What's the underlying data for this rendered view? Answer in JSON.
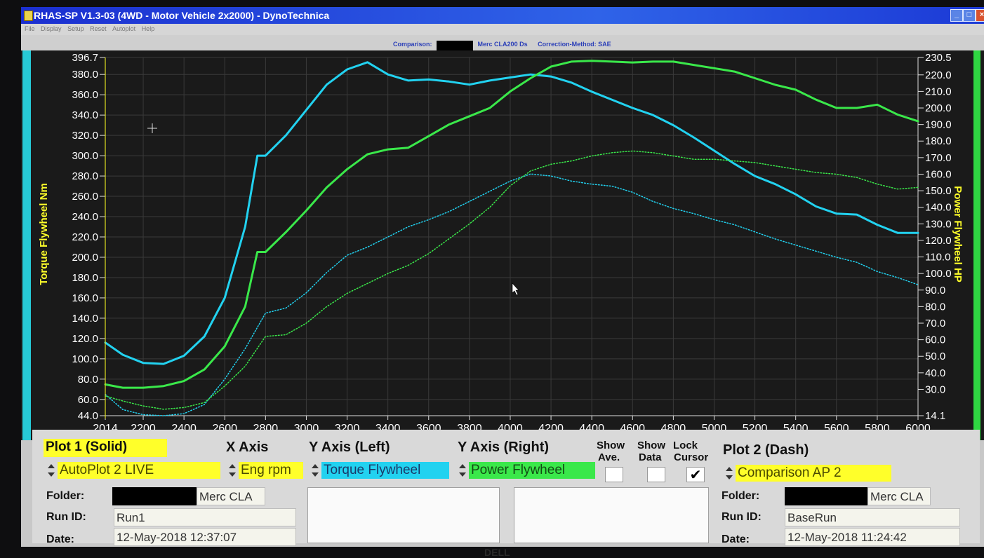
{
  "window": {
    "title": "RHAS-SP V1.3-03  (4WD - Motor Vehicle 2x2000) - DynoTechnica",
    "min_icon": "minimize-icon",
    "max_icon": "maximize-icon",
    "close_icon": "close-icon"
  },
  "menu": [
    "File",
    "Display",
    "Setup",
    "Reset",
    "Autoplot",
    "Help"
  ],
  "info_bar": {
    "comparison_label": "Comparison:",
    "comparison_value": "Merc CLA200 Ds",
    "correction_label": "Correction-Method: SAE"
  },
  "colors": {
    "torque": "#22d2f0",
    "power": "#3ae84a",
    "cursor": "#e0e020",
    "plot_bg": "#1a1a1a",
    "left_stripe": "#27c9d6",
    "right_stripe": "#2fd642",
    "label_yellow": "#ffff2a"
  },
  "chart_data": {
    "type": "line",
    "x_axis": {
      "label": "Eng rpm",
      "range": [
        2014,
        6000
      ],
      "ticks": [
        "2014",
        "2200",
        "2400",
        "2600",
        "2800",
        "3000",
        "3200",
        "3400",
        "3600",
        "3800",
        "4000",
        "4200",
        "4400",
        "4600",
        "4800",
        "5000",
        "5200",
        "5400",
        "5600",
        "5800",
        "6000"
      ]
    },
    "y_left": {
      "label": "Torque Flywheel Nm",
      "range": [
        44.0,
        396.7
      ],
      "ticks": [
        "396.7",
        "380.0",
        "360.0",
        "340.0",
        "320.0",
        "300.0",
        "280.0",
        "260.0",
        "240.0",
        "220.0",
        "200.0",
        "180.0",
        "160.0",
        "140.0",
        "120.0",
        "100.0",
        "80.0",
        "60.0",
        "44.0"
      ]
    },
    "y_right": {
      "label": "Power Flywheel HP",
      "range": [
        14.1,
        230.5
      ],
      "ticks": [
        "230.5",
        "220.0",
        "210.0",
        "200.0",
        "190.0",
        "180.0",
        "170.0",
        "160.0",
        "150.0",
        "140.0",
        "130.0",
        "120.0",
        "110.0",
        "100.0",
        "90.0",
        "80.0",
        "70.0",
        "60.0",
        "50.0",
        "40.0",
        "30.0",
        "14.1"
      ]
    },
    "grid": true,
    "cursor_x": 2014,
    "series": [
      {
        "name": "AutoPlot 2 LIVE",
        "quantity": "Torque",
        "axis": "left",
        "style": "solid",
        "points": [
          [
            2014,
            116
          ],
          [
            2100,
            104
          ],
          [
            2200,
            96
          ],
          [
            2300,
            95
          ],
          [
            2400,
            103
          ],
          [
            2500,
            122
          ],
          [
            2600,
            160
          ],
          [
            2700,
            230
          ],
          [
            2760,
            300
          ],
          [
            2800,
            300
          ],
          [
            2900,
            320
          ],
          [
            3000,
            345
          ],
          [
            3100,
            370
          ],
          [
            3200,
            385
          ],
          [
            3300,
            392
          ],
          [
            3400,
            380
          ],
          [
            3500,
            374
          ],
          [
            3600,
            375
          ],
          [
            3700,
            373
          ],
          [
            3800,
            370
          ],
          [
            3900,
            374
          ],
          [
            4000,
            377
          ],
          [
            4100,
            380
          ],
          [
            4200,
            378
          ],
          [
            4300,
            372
          ],
          [
            4400,
            363
          ],
          [
            4500,
            355
          ],
          [
            4600,
            347
          ],
          [
            4700,
            340
          ],
          [
            4800,
            330
          ],
          [
            4900,
            318
          ],
          [
            5000,
            305
          ],
          [
            5100,
            292
          ],
          [
            5200,
            280
          ],
          [
            5300,
            272
          ],
          [
            5400,
            262
          ],
          [
            5500,
            250
          ],
          [
            5600,
            243
          ],
          [
            5700,
            242
          ],
          [
            5800,
            232
          ],
          [
            5900,
            224
          ],
          [
            6000,
            224
          ]
        ]
      },
      {
        "name": "AutoPlot 2 LIVE",
        "quantity": "Power",
        "axis": "right",
        "style": "solid",
        "points": [
          [
            2014,
            33
          ],
          [
            2100,
            31
          ],
          [
            2200,
            31
          ],
          [
            2300,
            32
          ],
          [
            2400,
            35
          ],
          [
            2500,
            42
          ],
          [
            2600,
            56
          ],
          [
            2700,
            80
          ],
          [
            2760,
            113
          ],
          [
            2800,
            113
          ],
          [
            2900,
            125
          ],
          [
            3000,
            138
          ],
          [
            3100,
            152
          ],
          [
            3200,
            163
          ],
          [
            3300,
            172
          ],
          [
            3400,
            175
          ],
          [
            3500,
            176
          ],
          [
            3600,
            183
          ],
          [
            3700,
            190
          ],
          [
            3800,
            195
          ],
          [
            3900,
            200
          ],
          [
            4000,
            210
          ],
          [
            4100,
            218
          ],
          [
            4200,
            225
          ],
          [
            4300,
            228
          ],
          [
            4400,
            228.5
          ],
          [
            4500,
            228
          ],
          [
            4600,
            227.5
          ],
          [
            4700,
            228
          ],
          [
            4800,
            228
          ],
          [
            4900,
            226
          ],
          [
            5000,
            224
          ],
          [
            5100,
            222
          ],
          [
            5200,
            218
          ],
          [
            5300,
            214
          ],
          [
            5400,
            211
          ],
          [
            5500,
            205
          ],
          [
            5600,
            200
          ],
          [
            5700,
            200
          ],
          [
            5800,
            202
          ],
          [
            5900,
            196
          ],
          [
            6000,
            192
          ]
        ]
      },
      {
        "name": "Comparison AP 2",
        "quantity": "Torque",
        "axis": "left",
        "style": "dash",
        "points": [
          [
            2014,
            65
          ],
          [
            2100,
            50
          ],
          [
            2200,
            45
          ],
          [
            2300,
            44
          ],
          [
            2400,
            46
          ],
          [
            2500,
            55
          ],
          [
            2600,
            80
          ],
          [
            2700,
            110
          ],
          [
            2800,
            145
          ],
          [
            2900,
            150
          ],
          [
            3000,
            165
          ],
          [
            3100,
            185
          ],
          [
            3200,
            202
          ],
          [
            3300,
            210
          ],
          [
            3400,
            220
          ],
          [
            3500,
            230
          ],
          [
            3600,
            237
          ],
          [
            3700,
            245
          ],
          [
            3800,
            255
          ],
          [
            3900,
            265
          ],
          [
            4000,
            275
          ],
          [
            4100,
            282
          ],
          [
            4200,
            280
          ],
          [
            4300,
            275
          ],
          [
            4400,
            272
          ],
          [
            4500,
            270
          ],
          [
            4600,
            264
          ],
          [
            4700,
            255
          ],
          [
            4800,
            248
          ],
          [
            4900,
            243
          ],
          [
            5000,
            237
          ],
          [
            5100,
            232
          ],
          [
            5200,
            225
          ],
          [
            5300,
            218
          ],
          [
            5400,
            212
          ],
          [
            5500,
            206
          ],
          [
            5600,
            200
          ],
          [
            5700,
            195
          ],
          [
            5800,
            186
          ],
          [
            5900,
            180
          ],
          [
            6000,
            173
          ]
        ]
      },
      {
        "name": "Comparison AP 2",
        "quantity": "Power",
        "axis": "right",
        "style": "dash",
        "points": [
          [
            2014,
            26
          ],
          [
            2100,
            23
          ],
          [
            2200,
            20
          ],
          [
            2300,
            18
          ],
          [
            2400,
            19
          ],
          [
            2500,
            22
          ],
          [
            2600,
            32
          ],
          [
            2700,
            44
          ],
          [
            2800,
            62
          ],
          [
            2900,
            63
          ],
          [
            3000,
            70
          ],
          [
            3100,
            80
          ],
          [
            3200,
            88
          ],
          [
            3300,
            94
          ],
          [
            3400,
            100
          ],
          [
            3500,
            105
          ],
          [
            3600,
            112
          ],
          [
            3700,
            121
          ],
          [
            3800,
            130
          ],
          [
            3900,
            140
          ],
          [
            4000,
            153
          ],
          [
            4100,
            162
          ],
          [
            4200,
            166
          ],
          [
            4300,
            168
          ],
          [
            4400,
            171
          ],
          [
            4500,
            173
          ],
          [
            4600,
            174
          ],
          [
            4700,
            173
          ],
          [
            4800,
            171
          ],
          [
            4900,
            169
          ],
          [
            5000,
            169
          ],
          [
            5100,
            168
          ],
          [
            5200,
            167
          ],
          [
            5300,
            165
          ],
          [
            5400,
            163
          ],
          [
            5500,
            161
          ],
          [
            5600,
            160
          ],
          [
            5700,
            158
          ],
          [
            5800,
            154
          ],
          [
            5900,
            151
          ],
          [
            6000,
            152
          ]
        ]
      }
    ]
  },
  "controls": {
    "plot1": {
      "heading": "Plot 1 (Solid)",
      "value": "AutoPlot 2 LIVE",
      "folder_label": "Folder:",
      "folder_value": "Merc CLA",
      "runid_label": "Run ID:",
      "runid_value": "Run1",
      "date_label": "Date:",
      "date_value": "12-May-2018  12:37:07"
    },
    "x_axis": {
      "heading": "X Axis",
      "value": "Eng rpm"
    },
    "y_left": {
      "heading": "Y Axis (Left)",
      "value": "Torque Flywheel"
    },
    "y_right": {
      "heading": "Y Axis (Right)",
      "value": "Power Flywheel"
    },
    "show_ave": {
      "line1": "Show",
      "line2": "Ave.",
      "checked": false
    },
    "show_data": {
      "line1": "Show",
      "line2": "Data",
      "checked": false
    },
    "lock_cursor": {
      "line1": "Lock",
      "line2": "Cursor",
      "checked": true,
      "mark": "✔"
    },
    "plot2": {
      "heading": "Plot 2 (Dash)",
      "value": "Comparison AP 2",
      "folder_label": "Folder:",
      "folder_value": "Merc CLA",
      "runid_label": "Run ID:",
      "runid_value": "BaseRun",
      "date_label": "Date:",
      "date_value": "12-May-2018  11:24:42"
    }
  },
  "monitor_brand": "DELL"
}
